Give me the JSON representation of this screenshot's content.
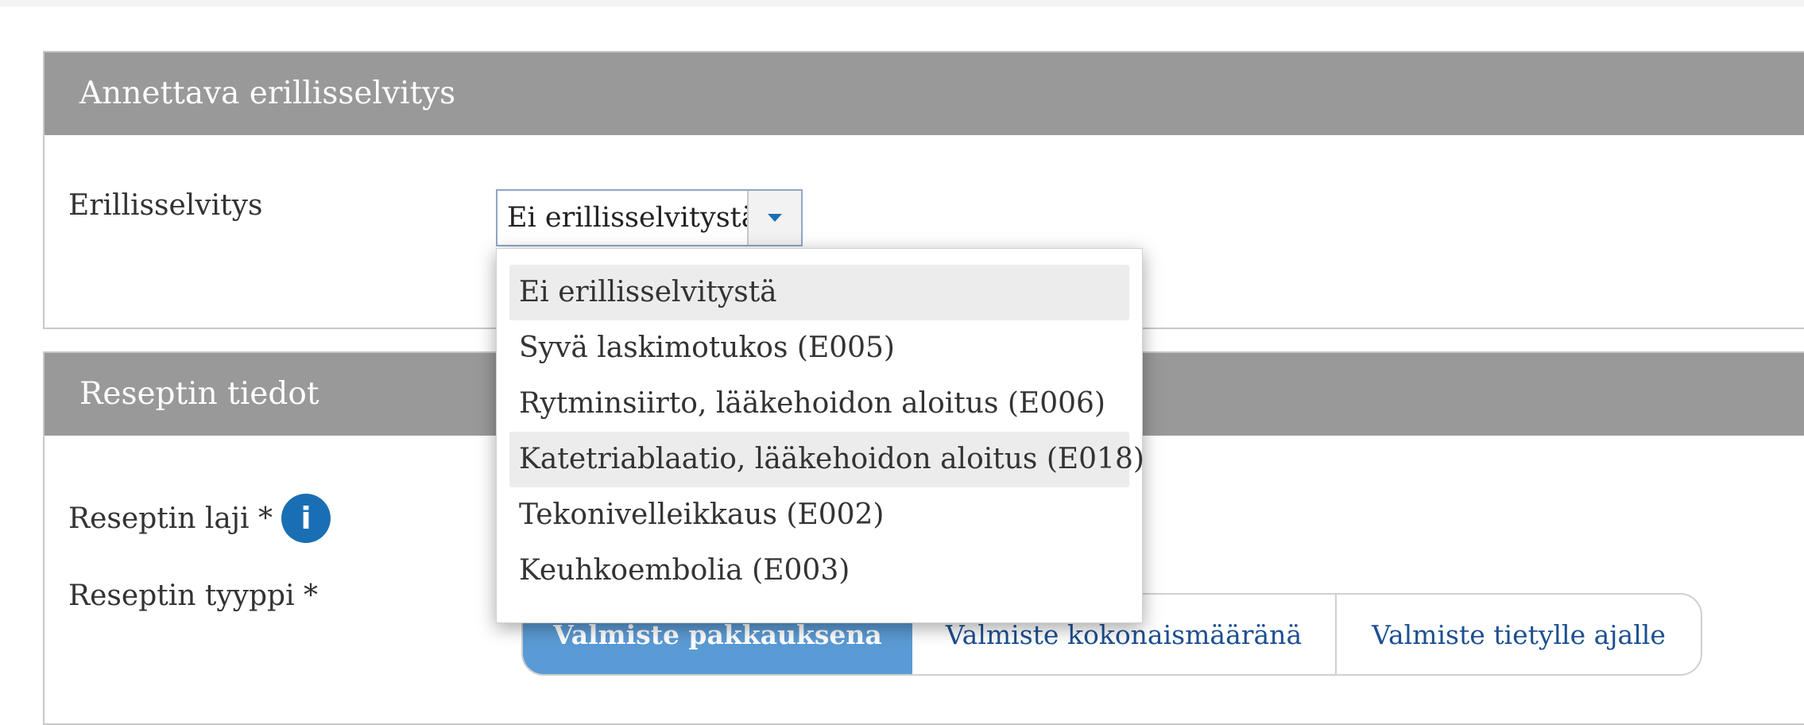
{
  "section_erillisselvitys": {
    "title": "Annettava erillisselvitys",
    "field_label": "Erillisselvitys",
    "selected_value": "Ei erillisselvitystä",
    "options": [
      "Ei erillisselvitystä",
      "Syvä laskimotukos (E005)",
      "Rytminsiirto, lääkehoidon aloitus (E006)",
      "Katetriablaatio, lääkehoidon aloitus (E018)",
      "Tekonivelleikkaus (E002)",
      "Keuhkoembolia (E003)"
    ]
  },
  "section_reseptin_tiedot": {
    "title": "Reseptin tiedot",
    "reseptin_laji_label": "Reseptin laji *",
    "info_icon_glyph": "i",
    "reseptin_tyyppi_label": "Reseptin tyyppi *",
    "type_options": [
      "Valmiste pakkauksena",
      "Valmiste kokonaismääränä",
      "Valmiste tietylle ajalle"
    ]
  },
  "icons": {
    "dropdown_arrow": "chevron-down-icon",
    "info": "info-icon"
  },
  "colors": {
    "header_bg": "#999999",
    "accent_blue": "#1a6fb4",
    "selected_segment": "#5b9bd5",
    "link_text": "#1d4f91"
  }
}
